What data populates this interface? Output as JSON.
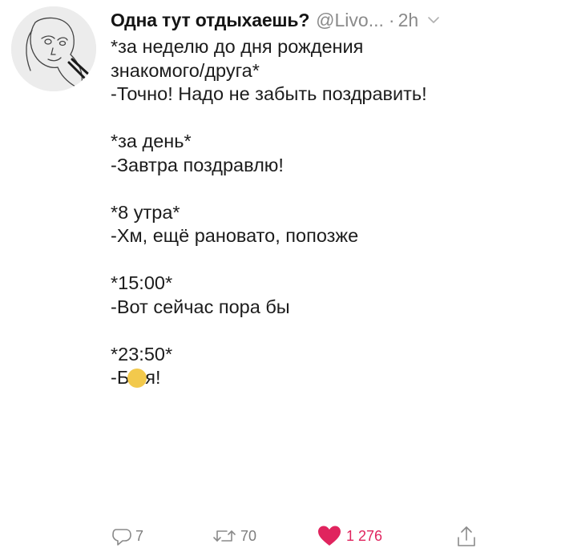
{
  "author": {
    "display_name": "Одна тут отдыхаешь?",
    "handle": "@Livo...",
    "separator": "·",
    "time": "2h"
  },
  "tweet": {
    "lines": [
      "*за неделю до дня рождения",
      "знакомого/друга*",
      "-Точно! Надо не забыть поздравить!",
      "",
      "*за день*",
      "-Завтра поздравлю!",
      "",
      "*8 утра*",
      "-Хм, ещё рановато, попозже",
      "",
      "*15:00*",
      "-Вот сейчас пора бы",
      "",
      "*23:50*"
    ],
    "last_line_start": "-Б",
    "last_line_end": "я!"
  },
  "actions": {
    "reply_count": "7",
    "retweet_count": "70",
    "like_count": "1 276"
  },
  "icons": {
    "avatar": "avatar-sketch",
    "chevron": "chevron-down-icon",
    "reply": "reply-icon",
    "retweet": "retweet-icon",
    "like": "heart-icon",
    "share": "share-icon"
  },
  "colors": {
    "like": "#e0245e",
    "muted": "#8a8a8a",
    "emoji": "#f2c94c"
  }
}
